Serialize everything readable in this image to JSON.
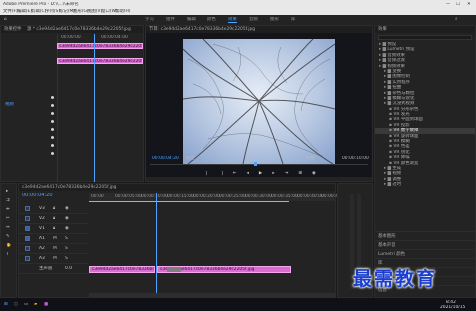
{
  "window": {
    "title": "Adobe Premiere Pro - D:\\\\...\\\\未命名",
    "controls": [
      "—",
      "☐",
      "✕"
    ]
  },
  "menu": [
    "文件(F)",
    "编辑(E)",
    "剪辑(C)",
    "序列(S)",
    "标记(M)",
    "图形(G)",
    "视图(V)",
    "窗口(W)",
    "帮助(H)"
  ],
  "workspace_tabs": [
    "学习",
    "组件",
    "编辑",
    "颜色",
    "效果",
    "音频",
    "图形",
    "库"
  ],
  "workspace_active": "效果",
  "source_panel": {
    "header": "效果控件",
    "clip_name": "源 * c3e94d2ae6417c0e78336b4e29c2205f.jpg",
    "sequence_label": "c3e94d2ae6417c0e78336b4e29c2205f.jpg",
    "timecodes": [
      "00:00:00",
      "00:00:04:00"
    ],
    "fx_label": "视频"
  },
  "program": {
    "header": "节目: c3e94d2ae6417c0e78336b4e29c2205f.jpg",
    "timecode_left": "00:00:04:20",
    "fit_label": "适合",
    "quality_label": "完整",
    "timecode_right": "00:00:10:00",
    "bg_color": "#14151a"
  },
  "effects_panel": {
    "header": "效果",
    "items": [
      {
        "label": "预设",
        "indent": 0,
        "selected": false
      },
      {
        "label": "Lumetri 预设",
        "indent": 0,
        "selected": false
      },
      {
        "label": "音频效果",
        "indent": 0,
        "selected": false
      },
      {
        "label": "音频过渡",
        "indent": 0,
        "selected": false
      },
      {
        "label": "视频效果",
        "indent": 0,
        "selected": false
      },
      {
        "label": "变换",
        "indent": 1,
        "selected": false
      },
      {
        "label": "图像控制",
        "indent": 1,
        "selected": false
      },
      {
        "label": "实用程序",
        "indent": 1,
        "selected": false
      },
      {
        "label": "扭曲",
        "indent": 1,
        "selected": false
      },
      {
        "label": "杂色与颗粒",
        "indent": 1,
        "selected": false
      },
      {
        "label": "模糊与锐化",
        "indent": 1,
        "selected": false
      },
      {
        "label": "沉浸式视频",
        "indent": 1,
        "selected": false
      },
      {
        "label": "VR 分形杂色",
        "indent": 2,
        "selected": false
      },
      {
        "label": "VR 发光",
        "indent": 2,
        "selected": false
      },
      {
        "label": "VR 平面到球面",
        "indent": 2,
        "selected": false
      },
      {
        "label": "VR 投影",
        "indent": 2,
        "selected": false
      },
      {
        "label": "VR 数字故障",
        "indent": 2,
        "selected": true
      },
      {
        "label": "VR 旋转球面",
        "indent": 2,
        "selected": false
      },
      {
        "label": "VR 模糊",
        "indent": 2,
        "selected": false
      },
      {
        "label": "VR 色差",
        "indent": 2,
        "selected": false
      },
      {
        "label": "VR 锐化",
        "indent": 2,
        "selected": false
      },
      {
        "label": "VR 降噪",
        "indent": 2,
        "selected": false
      },
      {
        "label": "VR 颜色渐变",
        "indent": 2,
        "selected": false
      },
      {
        "label": "生成",
        "indent": 1,
        "selected": false
      },
      {
        "label": "视频",
        "indent": 1,
        "selected": false
      },
      {
        "label": "调整",
        "indent": 1,
        "selected": false
      },
      {
        "label": "过时",
        "indent": 1,
        "selected": false
      }
    ],
    "side_panels": [
      "基本图形",
      "基本声音",
      "Lumetri 颜色",
      "库",
      "标记",
      "历史记录",
      "信息"
    ]
  },
  "timeline": {
    "header": "c3e94d2ae6417c0e78336b4e29c2205f.jpg",
    "timecode": "00:00:04:20",
    "ruler_ticks": [
      "00:00",
      "00:00:05:00",
      "00:00:10:00",
      "00:00:15:00",
      "00:00:20:00",
      "00:00:25:00",
      "00:00:30:00",
      "00:00:35:00",
      "00:00:40:00",
      "00:00:45:00"
    ],
    "tracks": [
      "V3",
      "V2",
      "V1",
      "A1",
      "A2",
      "A3",
      "主声道"
    ],
    "clip_v1": "c3e94d2ae6417c0e78336b4e29c2205f.jpg",
    "clip_v1_b": "c3e94d2ae6417c0e78336b4e29c2205f.jpg",
    "master_value": "0.0"
  },
  "source_clip": {
    "name": "c3e94d2ae6417c0e78336b4e29c2205f.jpg"
  },
  "taskbar": {
    "time": "8:42",
    "date": "2021/10/15"
  },
  "watermark": "最需教育"
}
